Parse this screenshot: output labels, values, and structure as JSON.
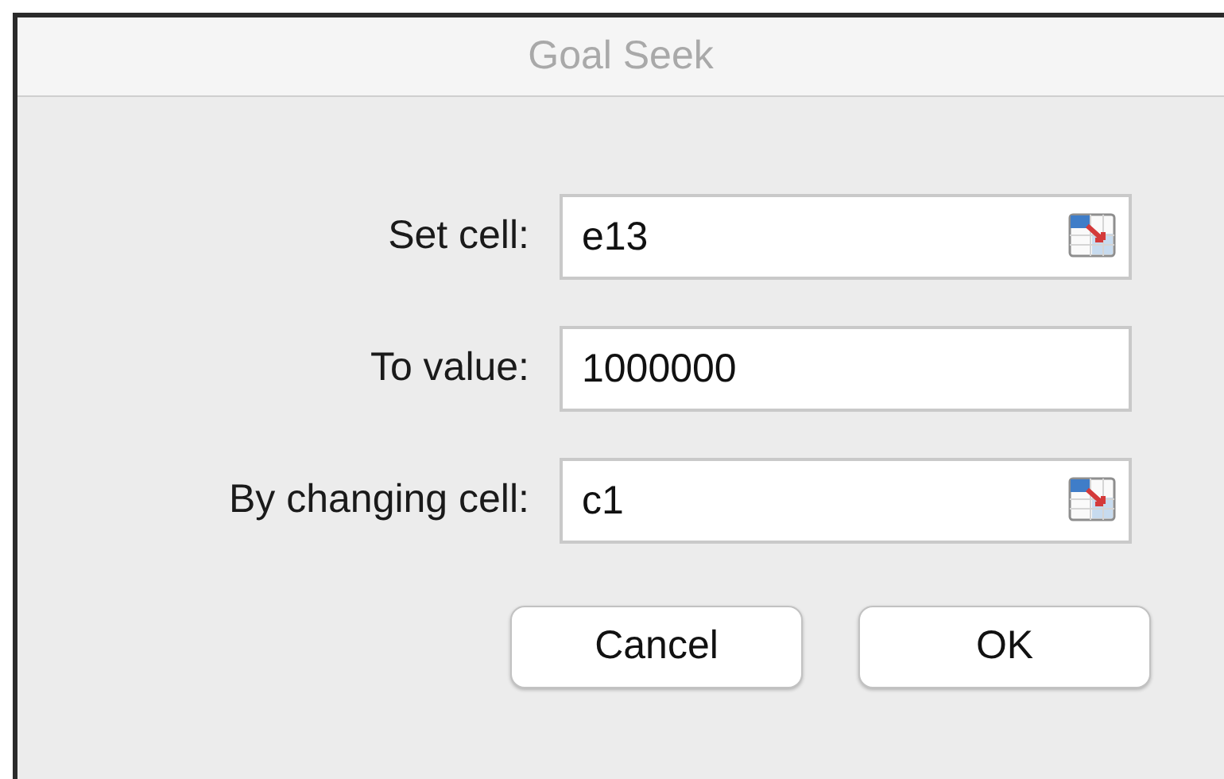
{
  "window": {
    "title": "Goal Seek"
  },
  "fields": [
    {
      "label": "Set cell:",
      "value": "e13",
      "kind": "reference"
    },
    {
      "label": "To value:",
      "value": "1000000",
      "kind": "plain"
    },
    {
      "label": "By changing cell:",
      "value": "c1",
      "kind": "reference"
    }
  ],
  "buttons": [
    {
      "label": "Cancel"
    },
    {
      "label": "OK"
    }
  ]
}
